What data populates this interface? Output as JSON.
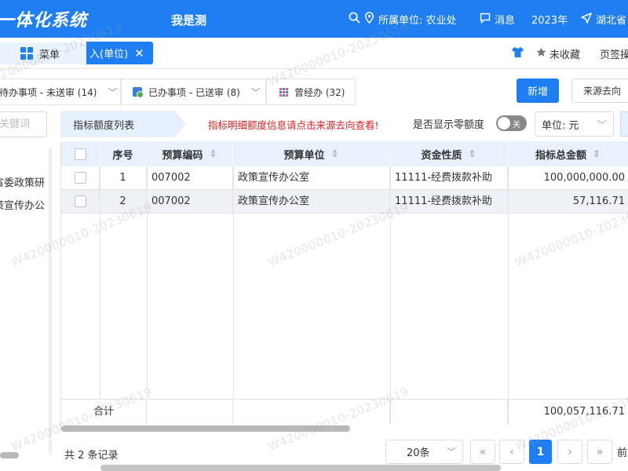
{
  "header": {
    "logo": "一体化系统",
    "system_name": "我是测",
    "search_icon": "search-icon",
    "unit_label": "所属单位: 农业处",
    "messages_label": "消息",
    "year_label": "2023年",
    "region_label": "湖北省"
  },
  "tabbar": {
    "menu_label": "菜单",
    "active_tab_label": "入(单位)",
    "favorite_label": "未收藏",
    "page_sign_label": "页签操"
  },
  "status_tabs": [
    {
      "label": "待办事项 - 未送审 (14)"
    },
    {
      "label": "已办事项 - 已送审 (8)"
    },
    {
      "label": "曾经办 (32)"
    }
  ],
  "actions": {
    "new_label": "新增",
    "trace_label": "来源去向"
  },
  "sidebar": {
    "search_placeholder": "关键词",
    "items": [
      {
        "label": "省委政策研"
      },
      {
        "label": "策宣传办公"
      }
    ]
  },
  "section": {
    "title": "指标额度列表",
    "hint": "指标明细额度信息请点击来源去向查看!",
    "zero_label": "是否显示零额度",
    "toggle_state": "关",
    "unit_label": "单位:",
    "unit_value": "元"
  },
  "table": {
    "columns": [
      "序号",
      "预算编码",
      "预算单位",
      "资金性质",
      "指标总金额"
    ],
    "rows": [
      {
        "index": "1",
        "code": "007002",
        "unit": "政策宣传办公室",
        "nature": "11111-经费拨款补助",
        "amount": "100,000,000.00"
      },
      {
        "index": "2",
        "code": "007002",
        "unit": "政策宣传办公室",
        "nature": "11111-经费拨款补助",
        "amount": "57,116.71"
      }
    ],
    "footer_label": "合计",
    "footer_total": "100,057,116.71"
  },
  "pagination": {
    "total_text": "共 2 条记录",
    "page_size": "20条",
    "current_page": "1",
    "more_label": "前"
  },
  "watermark": "W420000010-20230619",
  "colors": {
    "primary": "#1f7ef2",
    "hint_red": "#e02020"
  }
}
